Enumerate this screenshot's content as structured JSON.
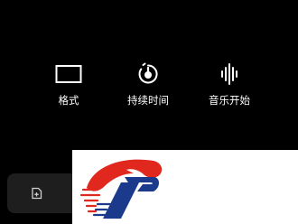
{
  "toolbar": {
    "format": {
      "label": "格式",
      "icon": "rectangle-frame-icon"
    },
    "duration": {
      "label": "持续时间",
      "icon": "timer-icon"
    },
    "music": {
      "label": "音乐开始",
      "icon": "sound-wave-icon"
    }
  },
  "side_button": {
    "icon": "add-media-icon"
  },
  "logo": {
    "icon": "red-blue-p-logo"
  },
  "colors": {
    "background": "#000000",
    "text": "#ffffff",
    "button_bg": "#1e1e1e",
    "logo_red": "#e0281f",
    "logo_blue": "#1c3a8c"
  }
}
